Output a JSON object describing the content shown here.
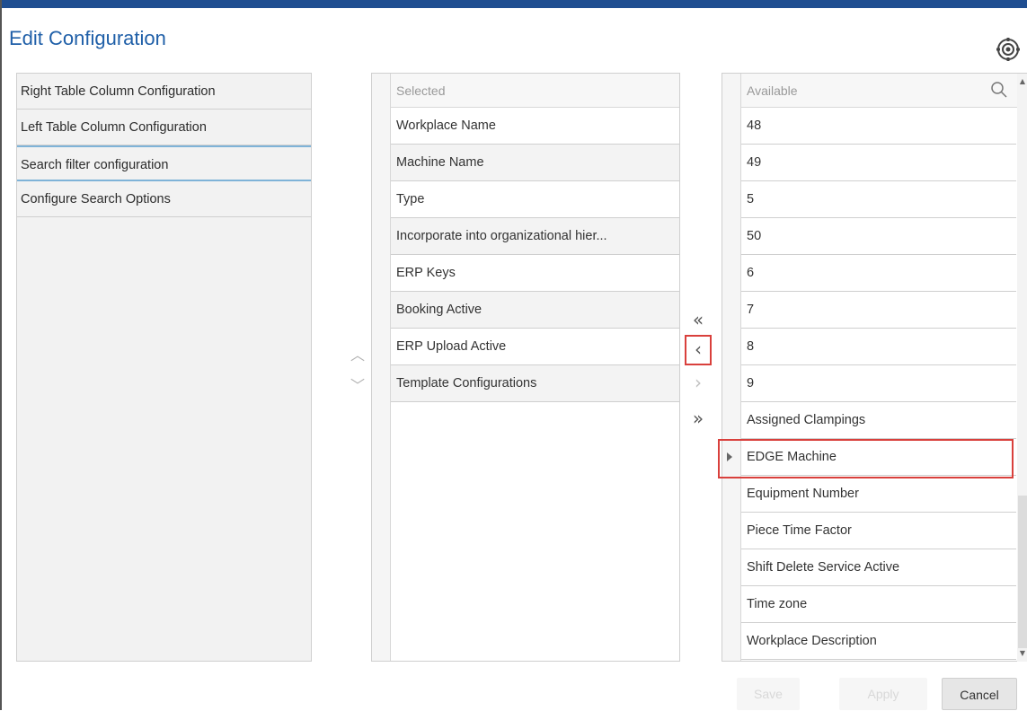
{
  "dialog": {
    "title": "Edit Configuration"
  },
  "menu": {
    "items": [
      {
        "label": "Right Table Column Configuration"
      },
      {
        "label": "Left Table Column Configuration"
      },
      {
        "label": "Search filter configuration"
      },
      {
        "label": "Configure Search Options"
      }
    ]
  },
  "selected": {
    "header": "Selected",
    "rows": [
      "Workplace Name",
      "Machine Name",
      "Type",
      "Incorporate into organizational hier...",
      "ERP Keys",
      "Booking Active",
      "ERP Upload Active",
      "Template Configurations"
    ]
  },
  "available": {
    "header": "Available",
    "rows": [
      "48",
      "49",
      "5",
      "50",
      "6",
      "7",
      "8",
      "9",
      "Assigned Clampings",
      "EDGE Machine",
      "Equipment Number",
      "Piece Time Factor",
      "Shift Delete Service Active",
      "Time zone",
      "Workplace Description"
    ],
    "current_row": "EDGE Machine"
  },
  "transfer": {
    "add_all": "«",
    "add_one": "‹",
    "remove_one": "›",
    "remove_all": "»"
  },
  "order": {
    "up": "︿",
    "down": "﹀"
  },
  "footer": {
    "save": "Save",
    "apply": "Apply",
    "cancel": "Cancel"
  },
  "colors": {
    "accent": "#1f5fa8",
    "top_bar": "#1f4e91",
    "highlight": "#d9403c"
  },
  "icons": {
    "settings": "settings-gear-icon",
    "search": "search-icon"
  }
}
